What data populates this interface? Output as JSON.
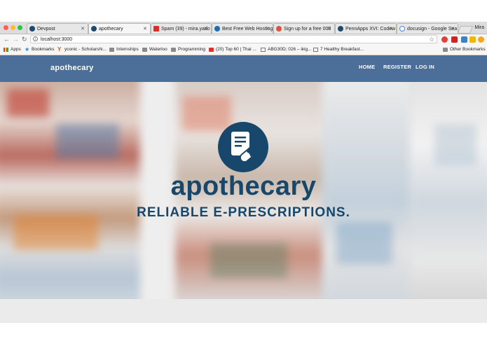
{
  "browser": {
    "tabs": [
      {
        "label": "Devpost",
        "favicon": "devpost-icon",
        "active": false
      },
      {
        "label": "apothecary",
        "favicon": "devpost-icon",
        "active": true
      },
      {
        "label": "Spam (39) - mira.yado",
        "favicon": "gmail-icon",
        "active": false
      },
      {
        "label": "Best Free Web Hosting",
        "favicon": "hosting-icon",
        "active": false
      },
      {
        "label": "Sign up for a free 000",
        "favicon": "hosting-icon",
        "active": false
      },
      {
        "label": "PennApps XVI: Codew",
        "favicon": "devpost-icon",
        "active": false
      },
      {
        "label": "docusign - Google Sea",
        "favicon": "google-icon",
        "active": false
      }
    ],
    "profile": "Mira",
    "url": "localhost:3000",
    "bookmarks": [
      {
        "label": "Apps",
        "icon": "apps-grid-icon"
      },
      {
        "label": "Bookmarks",
        "icon": "star-icon"
      },
      {
        "label": "yconic - Scholarshi...",
        "icon": "yconic-icon"
      },
      {
        "label": "Internships",
        "icon": "folder-icon"
      },
      {
        "label": "Waterloo",
        "icon": "folder-icon"
      },
      {
        "label": "Programming",
        "icon": "folder-icon"
      },
      {
        "label": "(20) Top 60 | Thai ...",
        "icon": "youtube-icon"
      },
      {
        "label": "ABG30D; 026 – ikig...",
        "icon": "page-icon"
      },
      {
        "label": "7 Healthy Breakfast...",
        "icon": "page-icon"
      },
      {
        "label": "Other Bookmarks",
        "icon": "folder-icon"
      }
    ]
  },
  "site": {
    "brand": "apothecary",
    "nav": {
      "home": "HOME",
      "register": "REGISTER",
      "login": "LOG IN"
    },
    "hero": {
      "title": "apothecary",
      "subtitle": "RELIABLE E-PRESCRIPTIONS.",
      "logo_icon": "prescription-pill-icon"
    }
  },
  "colors": {
    "navbar": "#4b6f98",
    "brand_dark": "#17476b"
  }
}
